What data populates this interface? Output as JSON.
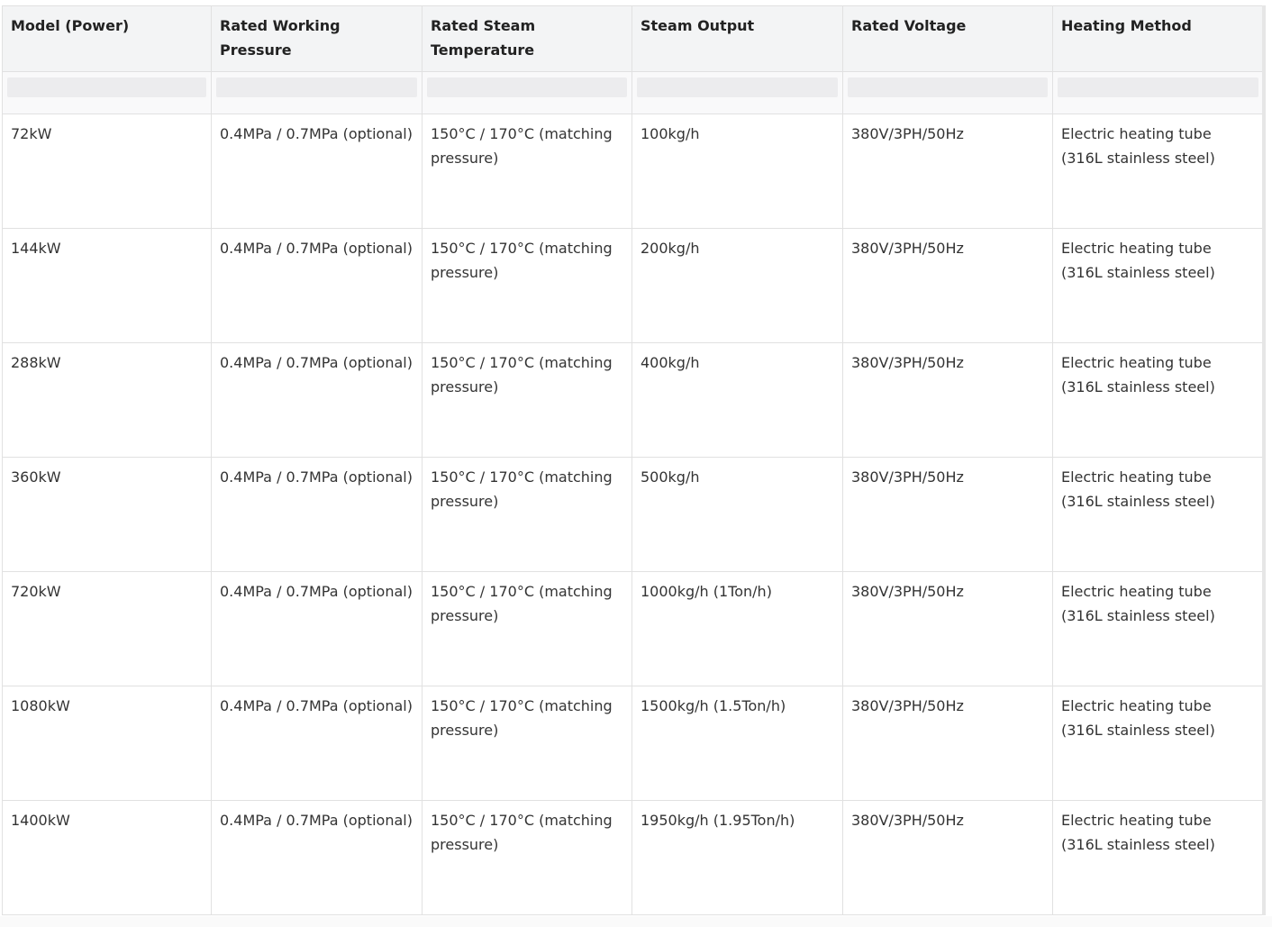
{
  "table": {
    "headers": [
      "Model (Power)",
      "Rated Working Pressure",
      "Rated Steam Temperature",
      "Steam Output",
      "Rated Voltage",
      "Heating Method"
    ],
    "rows": [
      [
        "72kW",
        "0.4MPa / 0.7MPa (optional)",
        "150°C / 170°C (matching pressure)",
        "100kg/h",
        "380V/3PH/50Hz",
        "Electric heating tube (316L stainless steel)"
      ],
      [
        "144kW",
        "0.4MPa / 0.7MPa (optional)",
        "150°C / 170°C (matching pressure)",
        "200kg/h",
        "380V/3PH/50Hz",
        "Electric heating tube (316L stainless steel)"
      ],
      [
        "288kW",
        "0.4MPa / 0.7MPa (optional)",
        "150°C / 170°C (matching pressure)",
        "400kg/h",
        "380V/3PH/50Hz",
        "Electric heating tube (316L stainless steel)"
      ],
      [
        "360kW",
        "0.4MPa / 0.7MPa (optional)",
        "150°C / 170°C (matching pressure)",
        "500kg/h",
        "380V/3PH/50Hz",
        "Electric heating tube (316L stainless steel)"
      ],
      [
        "720kW",
        "0.4MPa / 0.7MPa (optional)",
        "150°C / 170°C (matching pressure)",
        "1000kg/h (1Ton/h)",
        "380V/3PH/50Hz",
        "Electric heating tube (316L stainless steel)"
      ],
      [
        "1080kW",
        "0.4MPa / 0.7MPa (optional)",
        "150°C / 170°C (matching pressure)",
        "1500kg/h (1.5Ton/h)",
        "380V/3PH/50Hz",
        "Electric heating tube (316L stainless steel)"
      ],
      [
        "1400kW",
        "0.4MPa / 0.7MPa (optional)",
        "150°C / 170°C (matching pressure)",
        "1950kg/h (1.95Ton/h)",
        "380V/3PH/50Hz",
        "Electric heating tube (316L stainless steel)"
      ]
    ]
  }
}
